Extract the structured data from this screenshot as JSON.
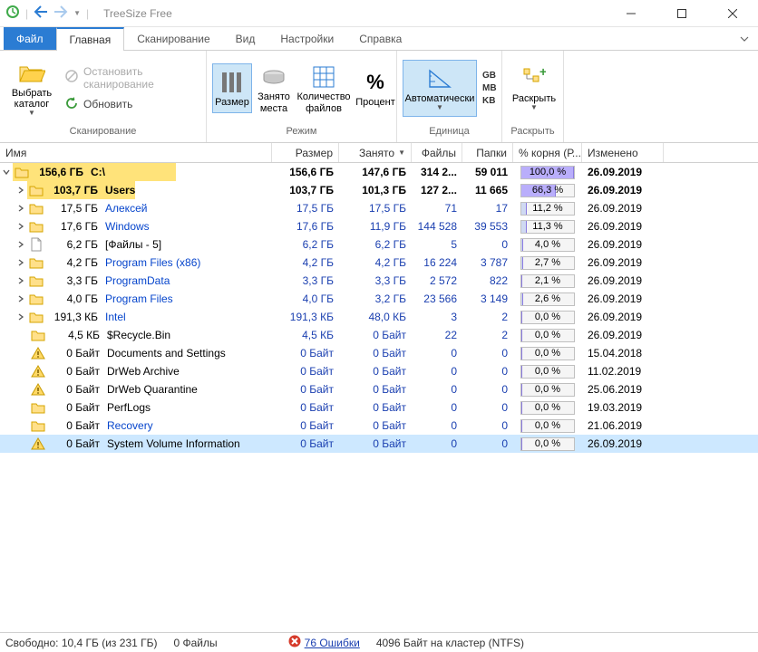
{
  "window": {
    "title": "TreeSize Free"
  },
  "tabs": {
    "file": "Файл",
    "home": "Главная",
    "scan": "Сканирование",
    "view": "Вид",
    "settings": "Настройки",
    "help": "Справка"
  },
  "ribbon": {
    "select_catalog": "Выбрать каталог",
    "stop_scan": "Остановить сканирование",
    "refresh": "Обновить",
    "group_scan": "Сканирование",
    "mode_size": "Размер",
    "mode_alloc": "Занято места",
    "mode_count": "Количество файлов",
    "mode_percent": "Процент",
    "group_mode": "Режим",
    "auto": "Автоматически",
    "u_gb": "GB",
    "u_mb": "MB",
    "u_kb": "KB",
    "group_unit": "Единица",
    "expand": "Раскрыть",
    "group_expand": "Раскрыть"
  },
  "columns": {
    "name": "Имя",
    "size": "Размер",
    "alloc": "Занято",
    "files": "Файлы",
    "folders": "Папки",
    "pct": "% корня (Р...",
    "mod": "Изменено"
  },
  "rows": [
    {
      "indent": 0,
      "exp": "open",
      "icon": "folder",
      "sizeInName": "156,6 ГБ",
      "name": "C:\\",
      "bold": true,
      "size": "156,6 ГБ",
      "alloc": "147,6 ГБ",
      "files": "314 2...",
      "folders": "59 011",
      "pct": "100,0 %",
      "pctFill": 100,
      "pctColor": "#b9aefb",
      "mod": "26.09.2019",
      "link": false,
      "bgFill": 100
    },
    {
      "indent": 1,
      "exp": "closed",
      "icon": "folder",
      "sizeInName": "103,7 ГБ",
      "name": "Users",
      "bold": true,
      "size": "103,7 ГБ",
      "alloc": "101,3 ГБ",
      "files": "127 2...",
      "folders": "11 665",
      "pct": "66,3 %",
      "pctFill": 66,
      "pctColor": "#b9aefb",
      "mod": "26.09.2019",
      "link": true,
      "bgFill": 66
    },
    {
      "indent": 1,
      "exp": "closed",
      "icon": "folder",
      "sizeInName": "17,5 ГБ",
      "name": "Алексей",
      "bold": false,
      "size": "17,5 ГБ",
      "alloc": "17,5 ГБ",
      "files": "71",
      "folders": "17",
      "pct": "11,2 %",
      "pctFill": 11,
      "pctColor": "#cfd9f2",
      "mod": "26.09.2019",
      "link": true,
      "bgFill": 0
    },
    {
      "indent": 1,
      "exp": "closed",
      "icon": "folder",
      "sizeInName": "17,6 ГБ",
      "name": "Windows",
      "bold": false,
      "size": "17,6 ГБ",
      "alloc": "11,9 ГБ",
      "files": "144 528",
      "folders": "39 553",
      "pct": "11,3 %",
      "pctFill": 11,
      "pctColor": "#cfd9f2",
      "mod": "26.09.2019",
      "link": true,
      "bgFill": 0
    },
    {
      "indent": 1,
      "exp": "closed",
      "icon": "file",
      "sizeInName": "6,2 ГБ",
      "name": "[Файлы - 5]",
      "bold": false,
      "size": "6,2 ГБ",
      "alloc": "6,2 ГБ",
      "files": "5",
      "folders": "0",
      "pct": "4,0 %",
      "pctFill": 4,
      "pctColor": "#cfd9f2",
      "mod": "26.09.2019",
      "link": false,
      "bgFill": 0
    },
    {
      "indent": 1,
      "exp": "closed",
      "icon": "folder",
      "sizeInName": "4,2 ГБ",
      "name": "Program Files (x86)",
      "bold": false,
      "size": "4,2 ГБ",
      "alloc": "4,2 ГБ",
      "files": "16 224",
      "folders": "3 787",
      "pct": "2,7 %",
      "pctFill": 3,
      "pctColor": "#cfd9f2",
      "mod": "26.09.2019",
      "link": true,
      "bgFill": 0
    },
    {
      "indent": 1,
      "exp": "closed",
      "icon": "folder",
      "sizeInName": "3,3 ГБ",
      "name": "ProgramData",
      "bold": false,
      "size": "3,3 ГБ",
      "alloc": "3,3 ГБ",
      "files": "2 572",
      "folders": "822",
      "pct": "2,1 %",
      "pctFill": 2,
      "pctColor": "#cfd9f2",
      "mod": "26.09.2019",
      "link": true,
      "bgFill": 0
    },
    {
      "indent": 1,
      "exp": "closed",
      "icon": "folder",
      "sizeInName": "4,0 ГБ",
      "name": "Program Files",
      "bold": false,
      "size": "4,0 ГБ",
      "alloc": "3,2 ГБ",
      "files": "23 566",
      "folders": "3 149",
      "pct": "2,6 %",
      "pctFill": 3,
      "pctColor": "#cfd9f2",
      "mod": "26.09.2019",
      "link": true,
      "bgFill": 0
    },
    {
      "indent": 1,
      "exp": "closed",
      "icon": "folder",
      "sizeInName": "191,3 КБ",
      "name": "Intel",
      "bold": false,
      "size": "191,3 КБ",
      "alloc": "48,0 КБ",
      "files": "3",
      "folders": "2",
      "pct": "0,0 %",
      "pctFill": 0,
      "pctColor": "#cfd9f2",
      "mod": "26.09.2019",
      "link": true,
      "bgFill": 0
    },
    {
      "indent": 1,
      "exp": "none",
      "icon": "folder",
      "sizeInName": "4,5 КБ",
      "name": "$Recycle.Bin",
      "bold": false,
      "size": "4,5 КБ",
      "alloc": "0 Байт",
      "files": "22",
      "folders": "2",
      "pct": "0,0 %",
      "pctFill": 0,
      "pctColor": "#cfd9f2",
      "mod": "26.09.2019",
      "link": false,
      "bgFill": 0
    },
    {
      "indent": 1,
      "exp": "none",
      "icon": "warn",
      "sizeInName": "0 Байт",
      "name": "Documents and Settings",
      "bold": false,
      "size": "0 Байт",
      "alloc": "0 Байт",
      "files": "0",
      "folders": "0",
      "pct": "0,0 %",
      "pctFill": 0,
      "pctColor": "#cfd9f2",
      "mod": "15.04.2018",
      "link": false,
      "bgFill": 0
    },
    {
      "indent": 1,
      "exp": "none",
      "icon": "warn",
      "sizeInName": "0 Байт",
      "name": "DrWeb Archive",
      "bold": false,
      "size": "0 Байт",
      "alloc": "0 Байт",
      "files": "0",
      "folders": "0",
      "pct": "0,0 %",
      "pctFill": 0,
      "pctColor": "#cfd9f2",
      "mod": "11.02.2019",
      "link": false,
      "bgFill": 0
    },
    {
      "indent": 1,
      "exp": "none",
      "icon": "warn",
      "sizeInName": "0 Байт",
      "name": "DrWeb Quarantine",
      "bold": false,
      "size": "0 Байт",
      "alloc": "0 Байт",
      "files": "0",
      "folders": "0",
      "pct": "0,0 %",
      "pctFill": 0,
      "pctColor": "#cfd9f2",
      "mod": "25.06.2019",
      "link": false,
      "bgFill": 0
    },
    {
      "indent": 1,
      "exp": "none",
      "icon": "folder",
      "sizeInName": "0 Байт",
      "name": "PerfLogs",
      "bold": false,
      "size": "0 Байт",
      "alloc": "0 Байт",
      "files": "0",
      "folders": "0",
      "pct": "0,0 %",
      "pctFill": 0,
      "pctColor": "#cfd9f2",
      "mod": "19.03.2019",
      "link": false,
      "bgFill": 0
    },
    {
      "indent": 1,
      "exp": "none",
      "icon": "folder",
      "sizeInName": "0 Байт",
      "name": "Recovery",
      "bold": false,
      "size": "0 Байт",
      "alloc": "0 Байт",
      "files": "0",
      "folders": "0",
      "pct": "0,0 %",
      "pctFill": 0,
      "pctColor": "#cfd9f2",
      "mod": "21.06.2019",
      "link": true,
      "bgFill": 0
    },
    {
      "indent": 1,
      "exp": "none",
      "icon": "warn",
      "sizeInName": "0 Байт",
      "name": "System Volume Information",
      "bold": false,
      "size": "0 Байт",
      "alloc": "0 Байт",
      "files": "0",
      "folders": "0",
      "pct": "0,0 %",
      "pctFill": 0,
      "pctColor": "#3a9be8",
      "mod": "26.09.2019",
      "link": false,
      "bgFill": 0,
      "selected": true
    }
  ],
  "status": {
    "free": "Свободно: 10,4 ГБ  (из 231 ГБ)",
    "files": "0  Файлы",
    "errors": "76 Ошибки",
    "cluster": "4096   Байт на кластер (NTFS)"
  }
}
